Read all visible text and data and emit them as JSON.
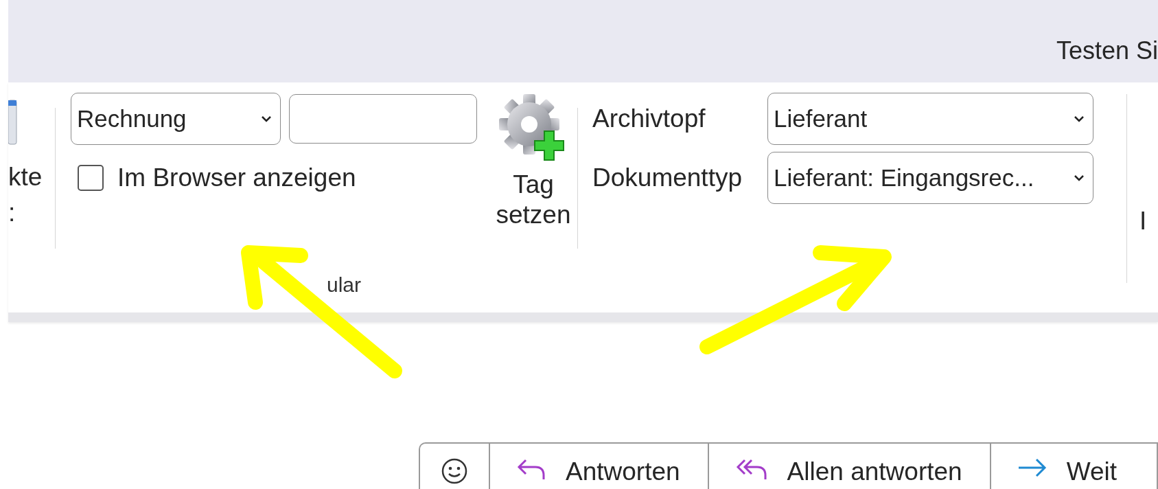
{
  "header": {
    "title": "Testen Si"
  },
  "ribbon": {
    "left_group": {
      "label_1": "kte",
      "label_2": ":"
    },
    "tag_group": {
      "dropdown": {
        "value": "Rechnung"
      },
      "checkbox": {
        "label": "Im Browser anzeigen",
        "checked": false
      },
      "button": {
        "label_1": "Tag",
        "label_2": "setzen"
      },
      "group_label": "ular"
    },
    "archive_group": {
      "fields": [
        {
          "label": "Archivtopf",
          "value": "Lieferant"
        },
        {
          "label": "Dokumenttyp",
          "value": "Lieferant: Eingangsrec..."
        }
      ]
    },
    "right_group": {
      "label": "I"
    }
  },
  "actions": [
    {
      "kind": "emoji"
    },
    {
      "kind": "reply",
      "label": "Antworten"
    },
    {
      "kind": "reply_all",
      "label": "Allen antworten"
    },
    {
      "kind": "forward",
      "label": "Weit"
    }
  ]
}
